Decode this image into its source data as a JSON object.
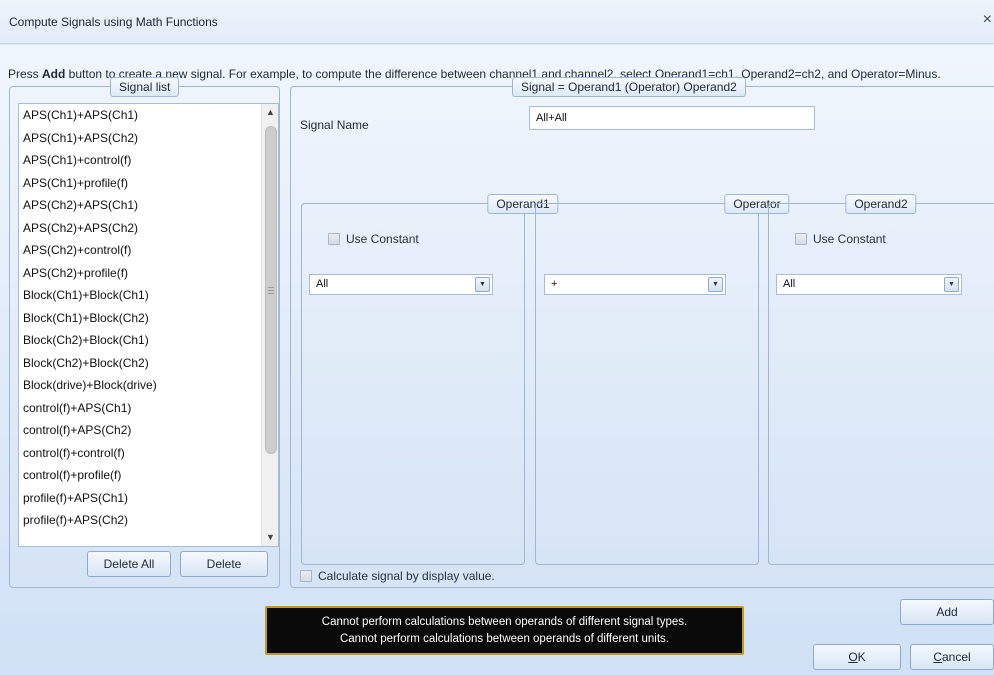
{
  "window": {
    "title": "Compute Signals using Math Functions",
    "close_glyph": "×"
  },
  "instructions": {
    "prefix": "Press ",
    "bold": "Add",
    "rest": " button to create a new signal. For example, to compute the difference between channel1 and channel2, select Operand1=ch1, Operand2=ch2, and Operator=Minus."
  },
  "signal_list": {
    "legend": "Signal list",
    "items": [
      "APS(Ch1)+APS(Ch1)",
      "APS(Ch1)+APS(Ch2)",
      "APS(Ch1)+control(f)",
      "APS(Ch1)+profile(f)",
      "APS(Ch2)+APS(Ch1)",
      "APS(Ch2)+APS(Ch2)",
      "APS(Ch2)+control(f)",
      "APS(Ch2)+profile(f)",
      "Block(Ch1)+Block(Ch1)",
      "Block(Ch1)+Block(Ch2)",
      "Block(Ch2)+Block(Ch1)",
      "Block(Ch2)+Block(Ch2)",
      "Block(drive)+Block(drive)",
      "control(f)+APS(Ch1)",
      "control(f)+APS(Ch2)",
      "control(f)+control(f)",
      "control(f)+profile(f)",
      "profile(f)+APS(Ch1)",
      "profile(f)+APS(Ch2)"
    ],
    "delete_all_label": "Delete All",
    "delete_label": "Delete"
  },
  "signal": {
    "legend": "Signal = Operand1 (Operator) Operand2",
    "name_label": "Signal Name",
    "name_value": "All+All",
    "operand1": {
      "legend": "Operand1",
      "use_constant_label": "Use Constant",
      "use_constant_checked": false,
      "selected": "All"
    },
    "operator": {
      "legend": "Operator",
      "selected": "+"
    },
    "operand2": {
      "legend": "Operand2",
      "use_constant_label": "Use Constant",
      "use_constant_checked": false,
      "selected": "All"
    },
    "calc_by_display_label": "Calculate signal by display value.",
    "calc_by_display_checked": false
  },
  "tooltip": {
    "line1": "Cannot perform calculations between operands of different signal types.",
    "line2": "Cannot perform calculations between operands of different units."
  },
  "buttons": {
    "add": "Add",
    "ok_mnemonic": "O",
    "ok_rest": "K",
    "cancel_mnemonic": "C",
    "cancel_rest": "ancel"
  },
  "icons": {
    "dropdown_arrow": "▼",
    "scroll_up": "▲",
    "scroll_down": "▼"
  }
}
